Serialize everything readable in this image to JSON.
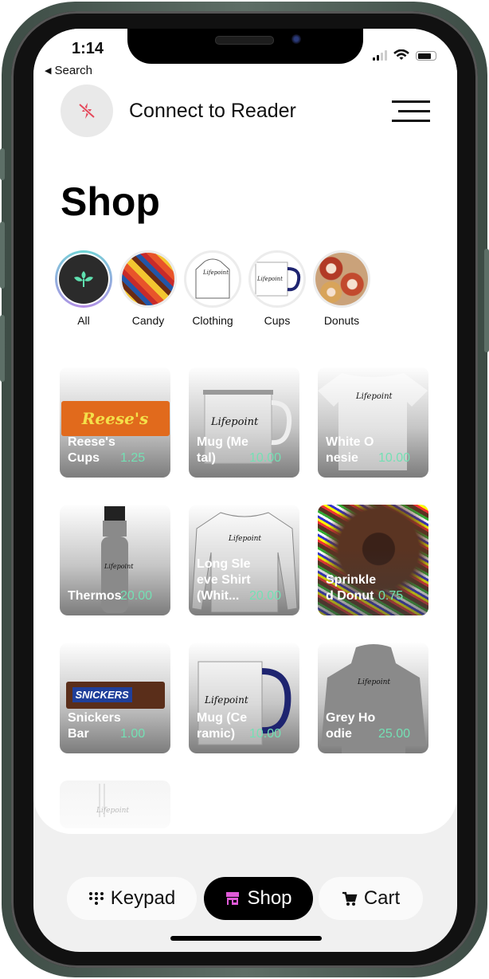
{
  "status_bar": {
    "time": "1:14",
    "back_label": "Search"
  },
  "header": {
    "reader_label": "Connect to Reader",
    "reader_icon": "bluetooth-off-icon",
    "menu_icon": "menu-icon"
  },
  "page_title": "Shop",
  "categories": [
    {
      "label": "All",
      "icon": "leaf-icon",
      "active": true
    },
    {
      "label": "Candy",
      "icon": "candy-image"
    },
    {
      "label": "Clothing",
      "icon": "hoodie-image"
    },
    {
      "label": "Cups",
      "icon": "mug-image"
    },
    {
      "label": "Donuts",
      "icon": "donuts-image"
    }
  ],
  "products": [
    {
      "name": "Reese's Cups",
      "price": "1.25",
      "art": "reeses"
    },
    {
      "name": "Mug (Metal)",
      "price": "10.00",
      "art": "metal-mug"
    },
    {
      "name": "White Onesie",
      "price": "10.00",
      "art": "onesie"
    },
    {
      "name": "Thermos",
      "price": "20.00",
      "art": "thermos"
    },
    {
      "name": "Long Sleeve Shirt (Whit...",
      "price": "20.00",
      "art": "longsleeve"
    },
    {
      "name": "Sprinkled Donut",
      "price": "0.75",
      "art": "donut"
    },
    {
      "name": "Snickers Bar",
      "price": "1.00",
      "art": "snickers"
    },
    {
      "name": "Mug (Ceramic)",
      "price": "10.00",
      "art": "ceramic-mug"
    },
    {
      "name": "Grey Hoodie",
      "price": "25.00",
      "art": "hoodie"
    }
  ],
  "tabbar": {
    "keypad": "Keypad",
    "shop": "Shop",
    "cart": "Cart",
    "active": "Shop"
  },
  "colors": {
    "accent_green": "#74e0b4",
    "shop_icon": "#e05ad8",
    "reader_icon": "#e5475a"
  }
}
